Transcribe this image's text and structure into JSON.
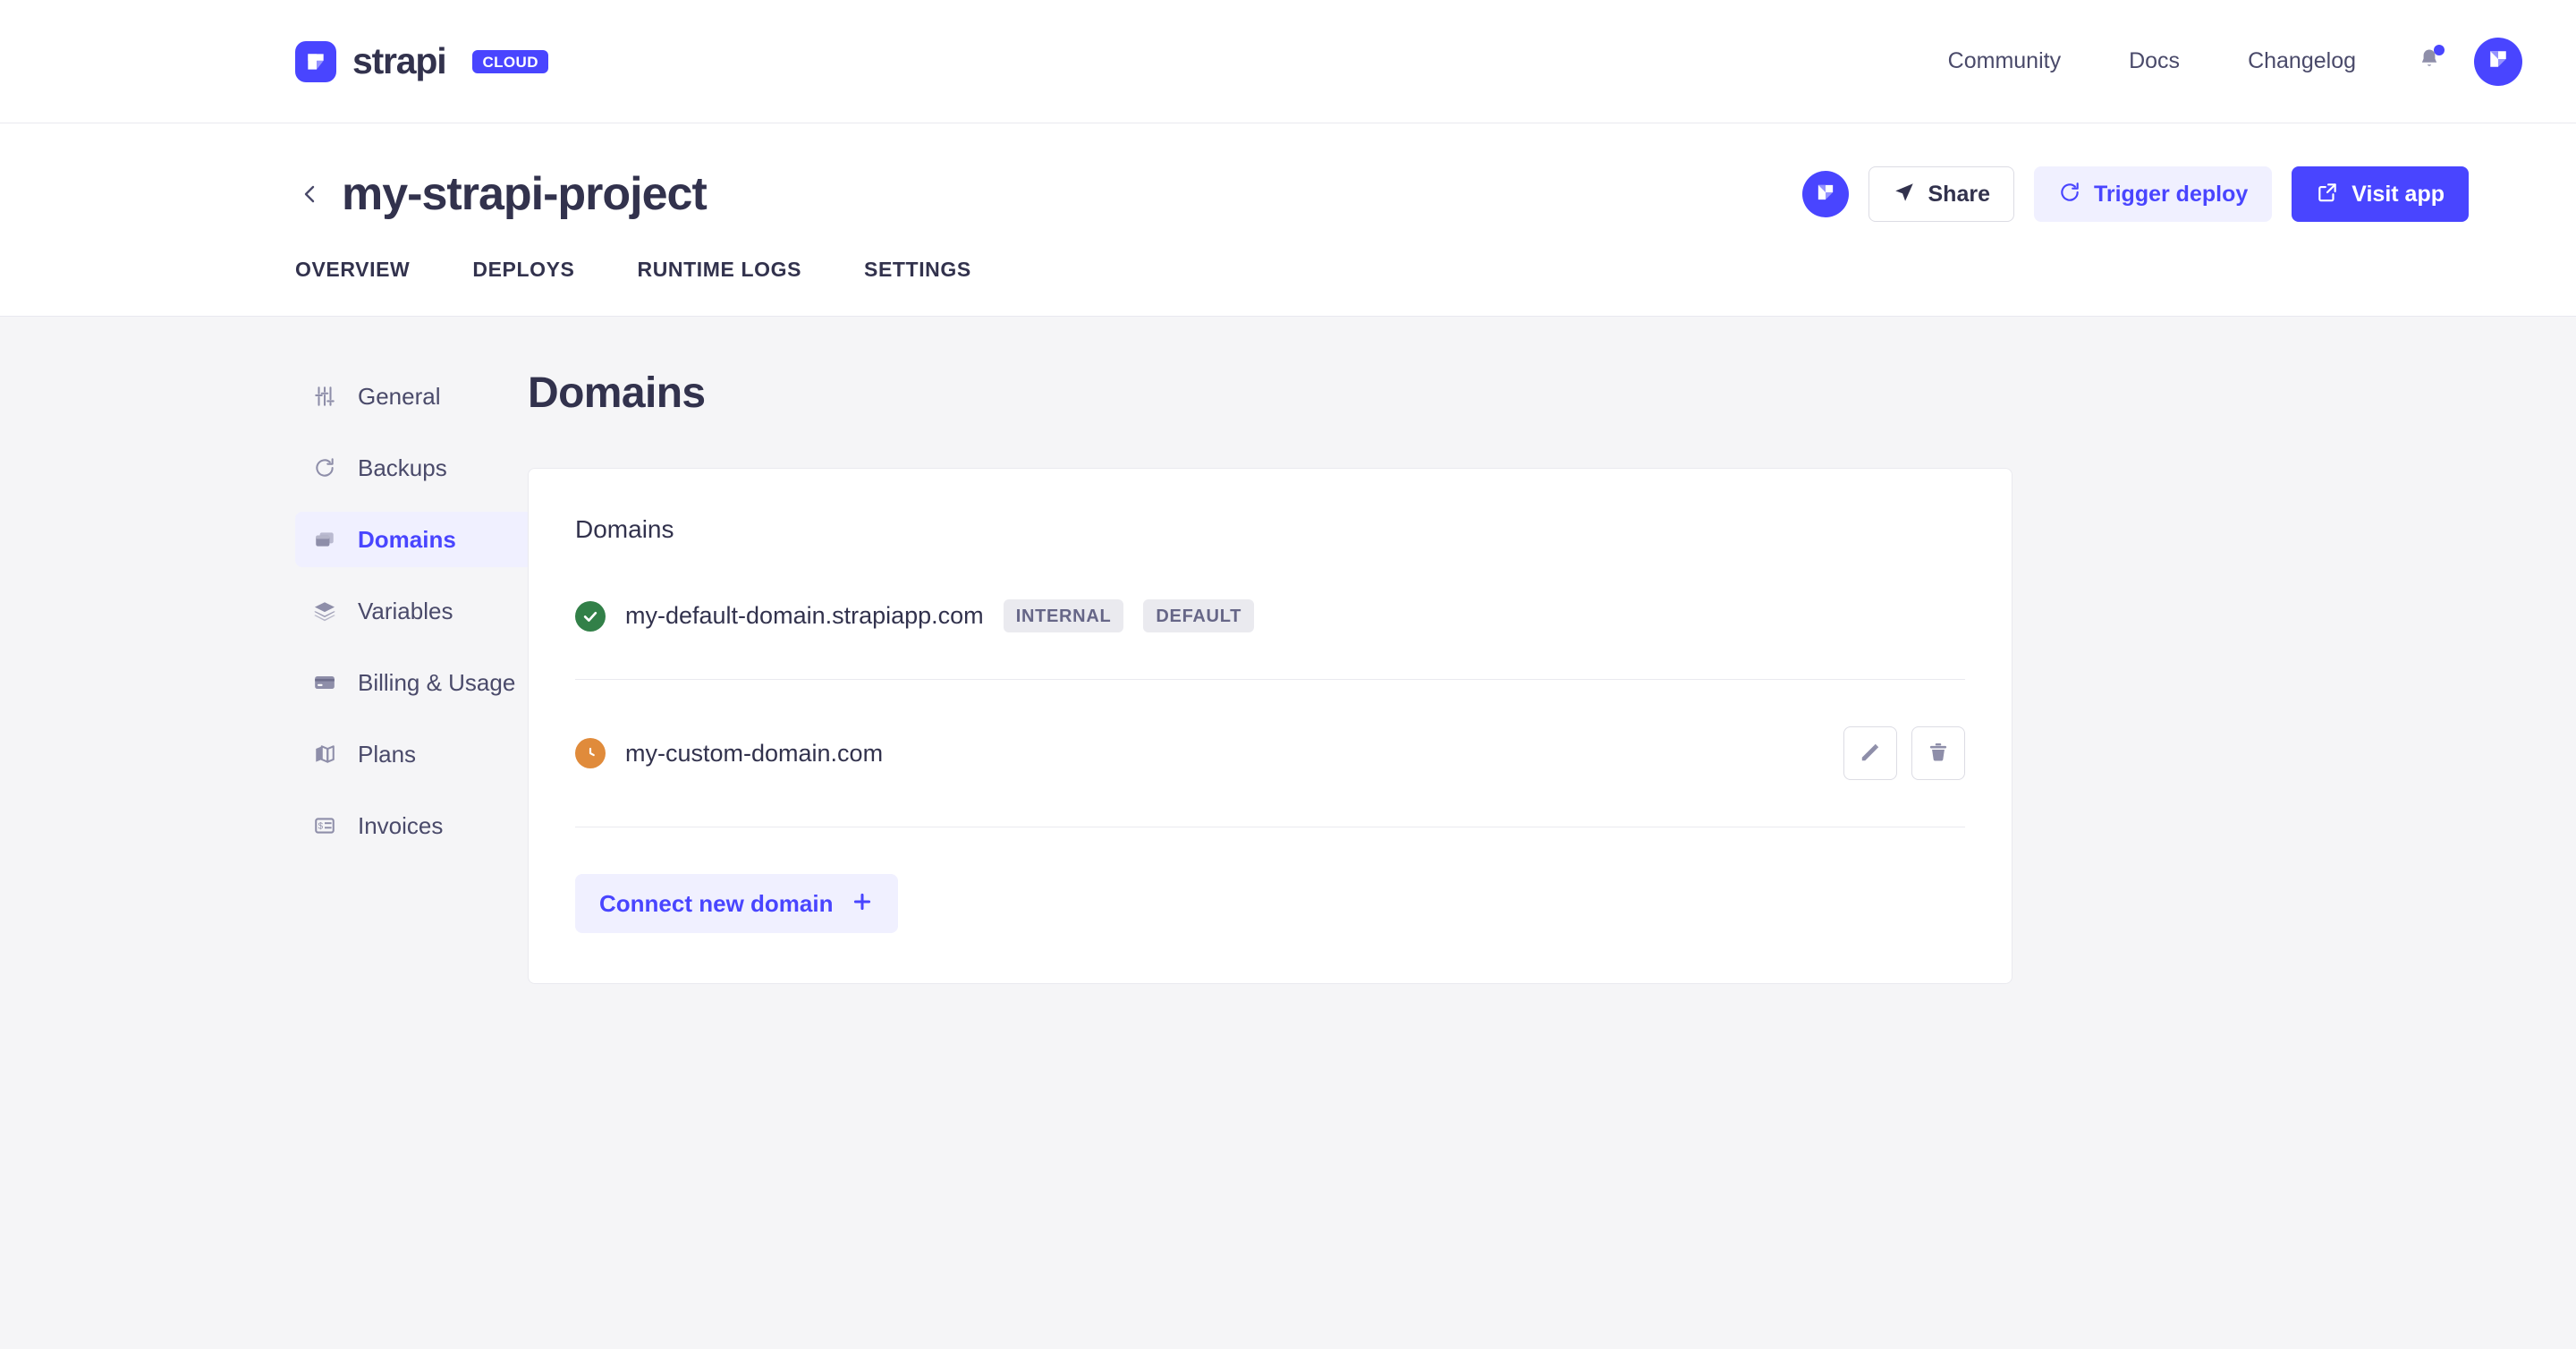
{
  "brand": {
    "name": "strapi",
    "chip": "CLOUD",
    "logo_icon": "strapi-logo-icon"
  },
  "topnav": {
    "links": [
      {
        "label": "Community"
      },
      {
        "label": "Docs"
      },
      {
        "label": "Changelog"
      }
    ],
    "notifications_icon": "bell-icon",
    "has_notification_dot": true,
    "avatar_icon": "strapi-avatar-icon"
  },
  "project_header": {
    "back_icon": "chevron-left-icon",
    "title": "my-strapi-project",
    "avatar_icon": "strapi-avatar-icon",
    "actions": [
      {
        "label": "Share",
        "icon": "send-icon",
        "style": "ghost"
      },
      {
        "label": "Trigger deploy",
        "icon": "refresh-icon",
        "style": "soft"
      },
      {
        "label": "Visit app",
        "icon": "external-link-icon",
        "style": "solid"
      }
    ]
  },
  "tabs": [
    {
      "label": "OVERVIEW",
      "active": false
    },
    {
      "label": "DEPLOYS",
      "active": false
    },
    {
      "label": "RUNTIME LOGS",
      "active": false
    },
    {
      "label": "SETTINGS",
      "active": false
    }
  ],
  "sidebar": {
    "items": [
      {
        "label": "General",
        "icon": "sliders-icon",
        "active": false
      },
      {
        "label": "Backups",
        "icon": "refresh-icon",
        "active": false
      },
      {
        "label": "Domains",
        "icon": "layers-window-icon",
        "active": true
      },
      {
        "label": "Variables",
        "icon": "stack-icon",
        "active": false
      },
      {
        "label": "Billing & Usage",
        "icon": "credit-card-icon",
        "active": false
      },
      {
        "label": "Plans",
        "icon": "map-icon",
        "active": false
      },
      {
        "label": "Invoices",
        "icon": "receipt-icon",
        "active": false
      }
    ]
  },
  "main": {
    "page_title": "Domains",
    "card_title": "Domains",
    "domains": [
      {
        "name": "my-default-domain.strapiapp.com",
        "status": "ok",
        "status_icon": "check-circle-icon",
        "badges": [
          "INTERNAL",
          "DEFAULT"
        ],
        "actions": []
      },
      {
        "name": "my-custom-domain.com",
        "status": "pending",
        "status_icon": "clock-icon",
        "badges": [],
        "actions": [
          {
            "icon": "pencil-icon",
            "name": "edit-domain-button"
          },
          {
            "icon": "trash-icon",
            "name": "delete-domain-button"
          }
        ]
      }
    ],
    "connect_button": {
      "label": "Connect new domain",
      "icon": "plus-icon"
    }
  },
  "colors": {
    "accent": "#4945ff",
    "accent_soft": "#f0f0ff",
    "text_dark": "#32324d",
    "text_muted": "#666687",
    "status_ok": "#328048",
    "status_pending": "#e08b3b",
    "page_bg": "#f5f5f7",
    "border": "#eaeaef"
  }
}
